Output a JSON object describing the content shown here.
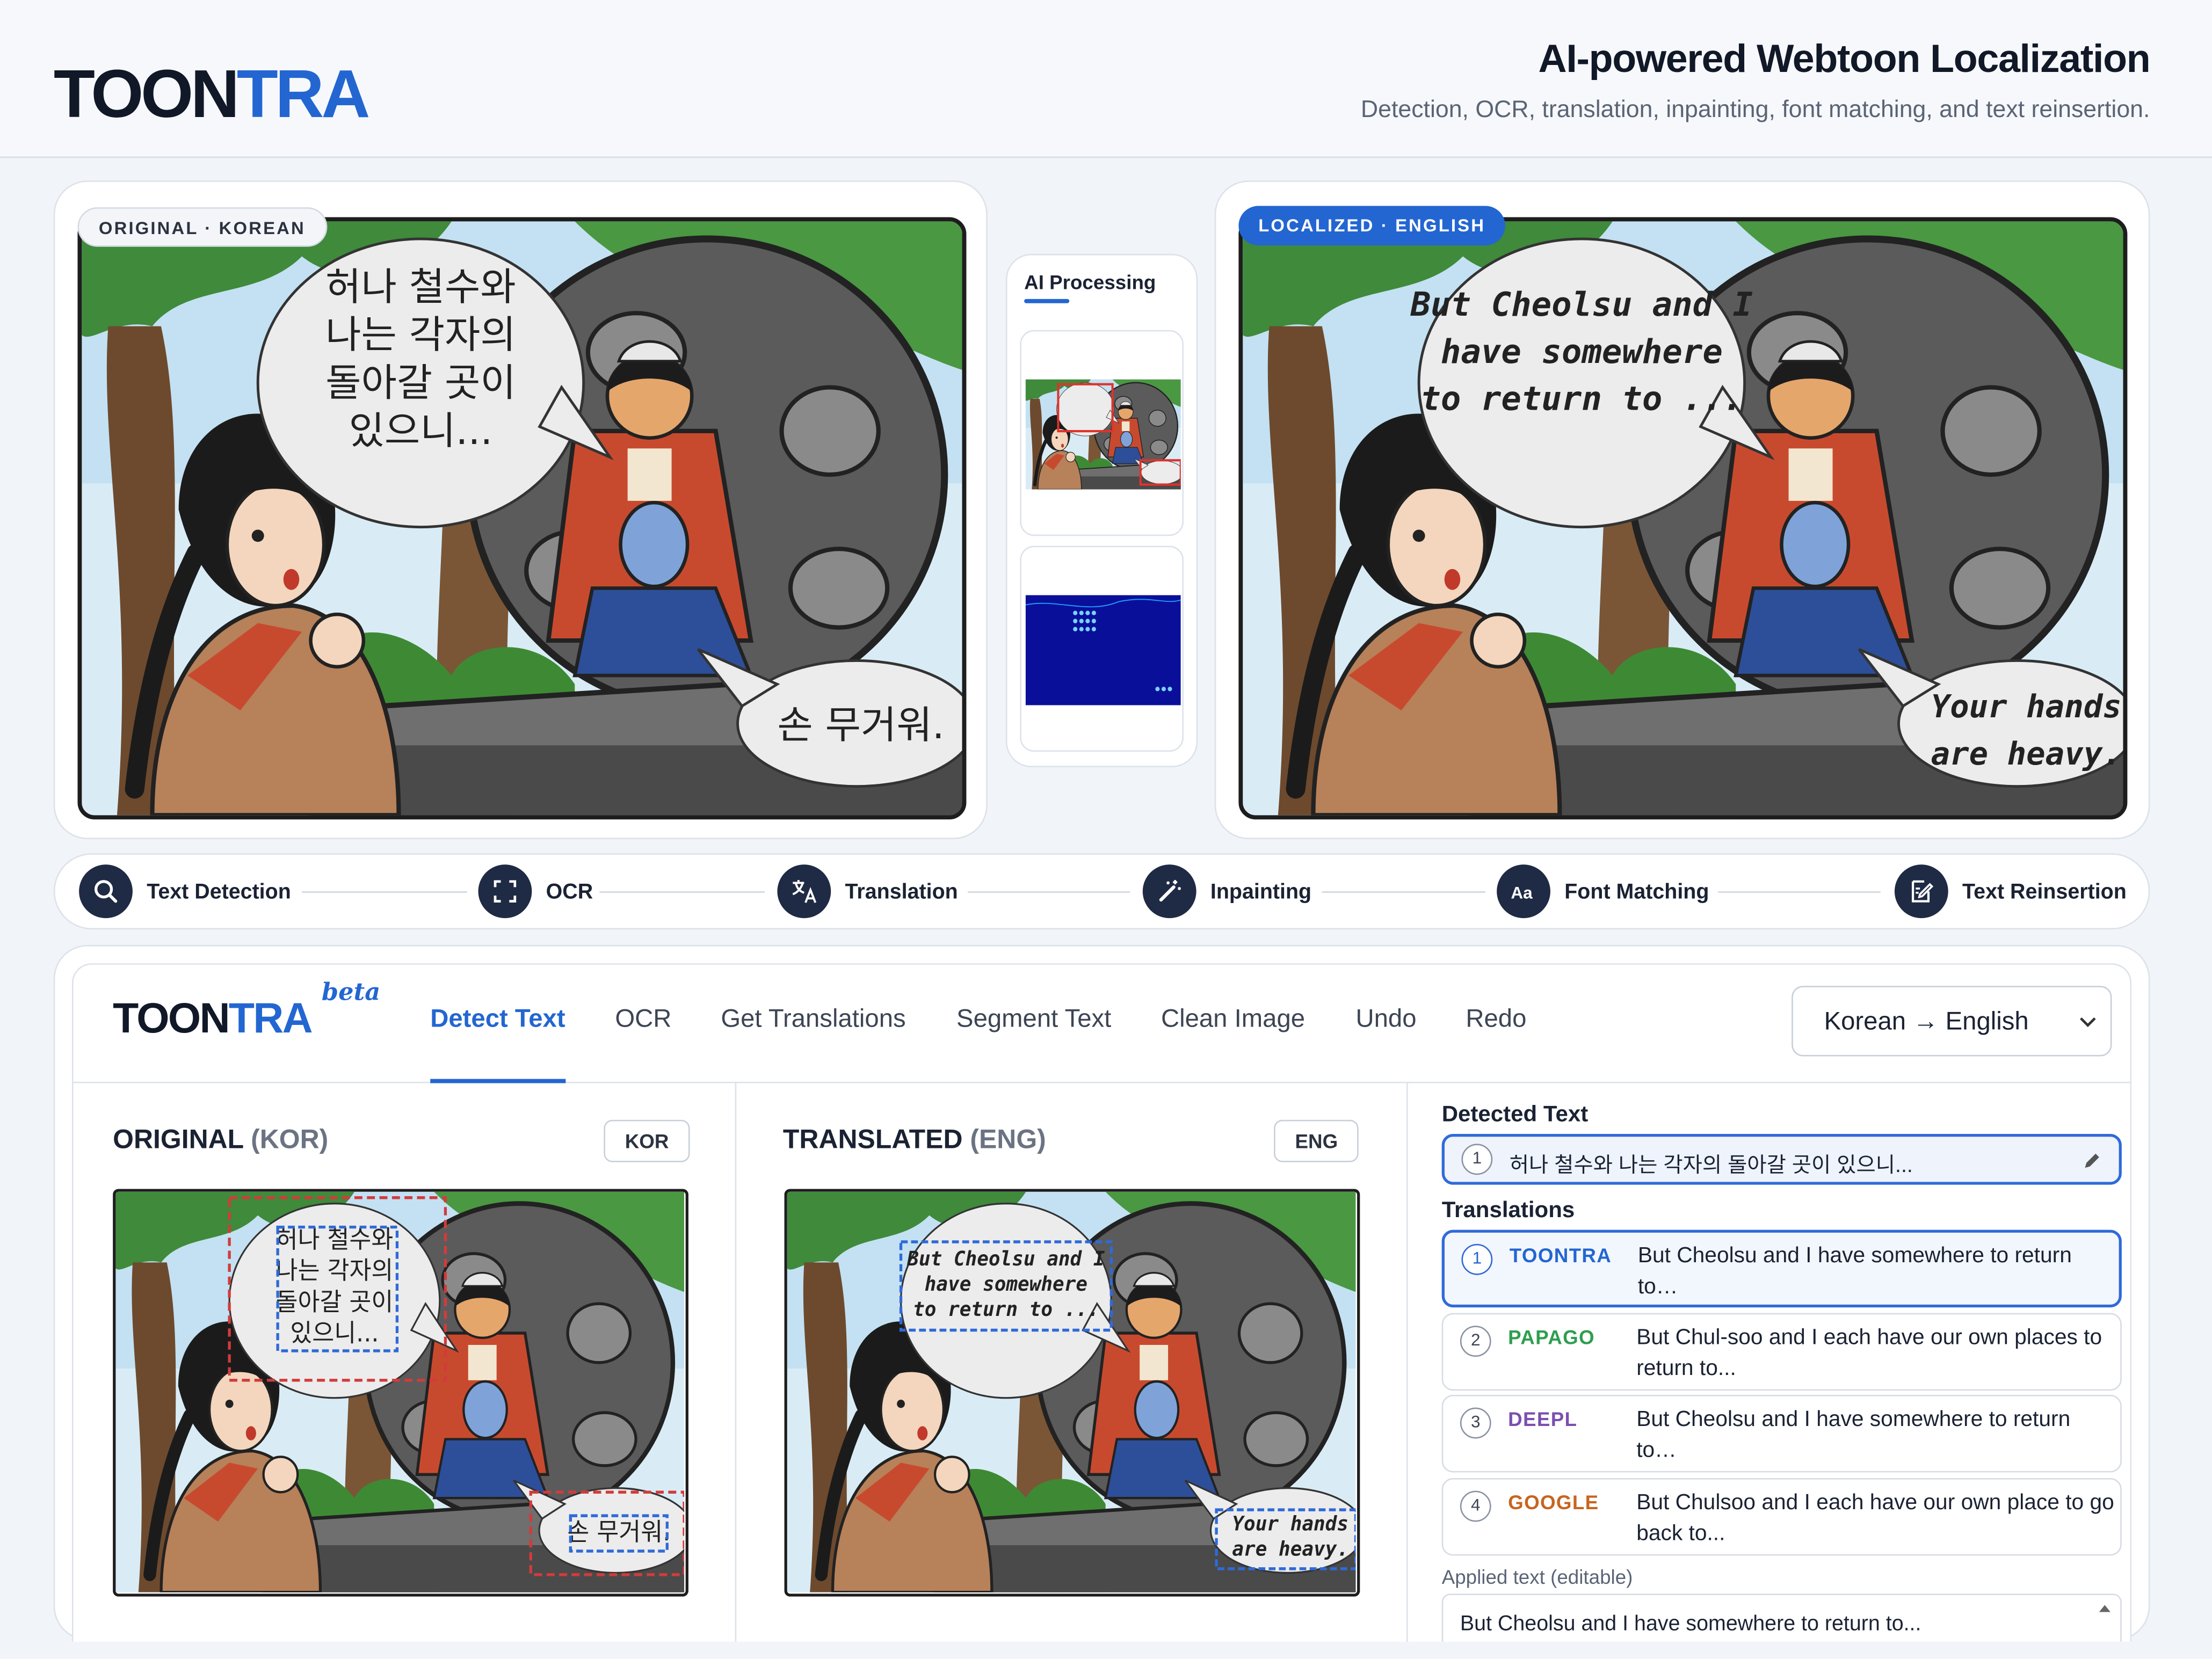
{
  "header": {
    "logo_dark": "TOON",
    "logo_blue": "TRA",
    "title": "AI-powered Webtoon Localization",
    "subtitle": "Detection, OCR, translation, inpainting, font matching, and text reinsertion."
  },
  "comparison": {
    "original_badge": "ORIGINAL · KOREAN",
    "localized_badge": "LOCALIZED · ENGLISH",
    "korean_bubble": [
      "허나 철수와",
      "나는 각자의",
      "돌아갈 곳이",
      "있으니..."
    ],
    "korean_small": "손 무거워.",
    "english_bubble": [
      "But Cheolsu and I",
      "have somewhere",
      "to return to ..."
    ],
    "english_small": [
      "Your hands",
      "are heavy."
    ],
    "ai_processing_label": "AI Processing"
  },
  "pipeline": [
    {
      "label": "Text Detection",
      "icon": "search-icon"
    },
    {
      "label": "OCR",
      "icon": "scan-icon"
    },
    {
      "label": "Translation",
      "icon": "translate-icon"
    },
    {
      "label": "Inpainting",
      "icon": "magic-wand-icon"
    },
    {
      "label": "Font Matching",
      "icon": "font-icon"
    },
    {
      "label": "Text Reinsertion",
      "icon": "edit-document-icon"
    }
  ],
  "app": {
    "logo_dark": "TOON",
    "logo_blue": "TRA",
    "beta": "beta",
    "tabs": [
      "Detect Text",
      "OCR",
      "Get Translations",
      "Segment Text",
      "Clean Image",
      "Undo",
      "Redo"
    ],
    "active_tab": "Detect Text",
    "language_select": "Korean → English",
    "original_title": "ORIGINAL",
    "original_code": "(KOR)",
    "original_lang": "KOR",
    "translated_title": "TRANSLATED",
    "translated_code": "(ENG)",
    "translated_lang": "ENG",
    "detected_text_label": "Detected Text",
    "detected_text": {
      "number": "1",
      "text": "허나 철수와 나는 각자의 돌아갈 곳이 있으니..."
    },
    "translations_label": "Translations",
    "translations": [
      {
        "number": "1",
        "engine": "TOONTRA",
        "color": "#2366d1",
        "text": "But Cheolsu and I have somewhere to return to…"
      },
      {
        "number": "2",
        "engine": "PAPAGO",
        "color": "#2e9e4f",
        "text": "But Chul-soo and I each have our own places to return to..."
      },
      {
        "number": "3",
        "engine": "DEEPL",
        "color": "#7a4fb0",
        "text": "But Cheolsu and I have somewhere to return to…"
      },
      {
        "number": "4",
        "engine": "GOOGLE",
        "color": "#c8641e",
        "text": "But Chulsoo and I each have our own place to go back to..."
      }
    ],
    "applied_label": "Applied text (editable)",
    "applied_text": "But Cheolsu and I have somewhere to return to..."
  },
  "colors": {
    "accent": "#2366d1",
    "dark": "#1f2a44"
  }
}
